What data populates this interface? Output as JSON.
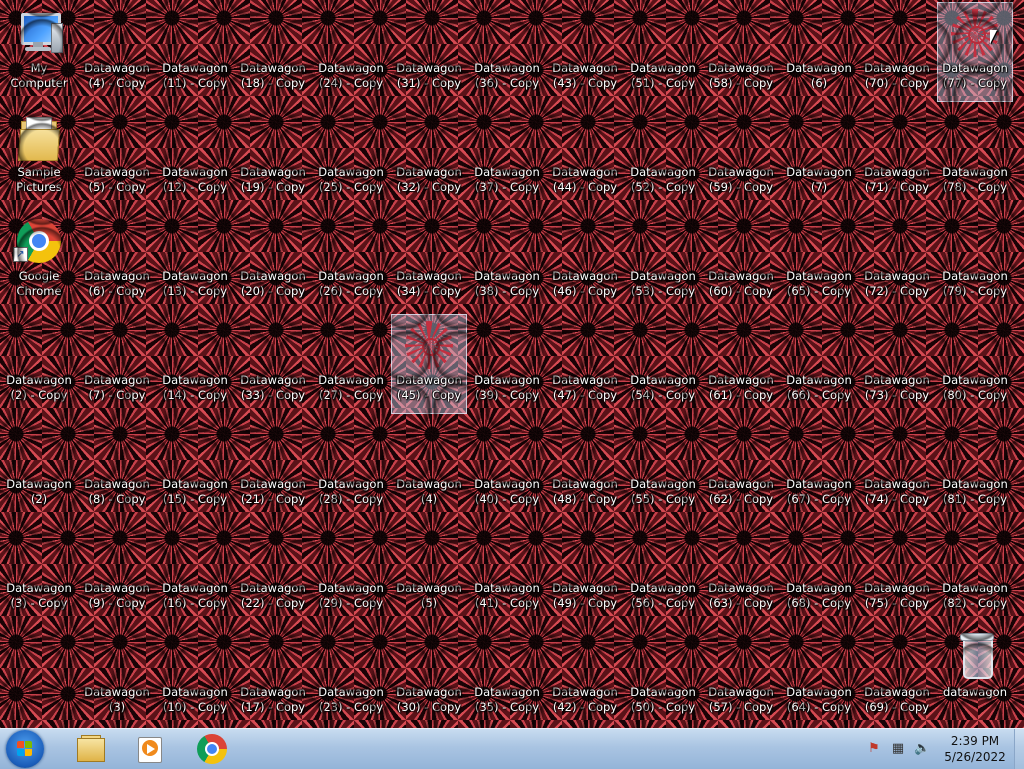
{
  "desktop": {
    "system_icons": [
      {
        "name": "my-computer-icon",
        "label": "My Computer",
        "kind": "computer",
        "col": 0,
        "row": 0
      },
      {
        "name": "sample-pictures-icon",
        "label": "Sample Pictures",
        "kind": "folder",
        "col": 0,
        "row": 1
      },
      {
        "name": "google-chrome-icon",
        "label": "Google Chrome",
        "kind": "chrome",
        "col": 0,
        "row": 2
      },
      {
        "name": "recycle-bin-icon",
        "label": "datawagon",
        "kind": "bin",
        "col": 12,
        "row": 6
      }
    ],
    "file_icons": [
      [
        "Datawagon (4) - Copy",
        "Datawagon (11) - Copy",
        "Datawagon (18) - Copy",
        "Datawagon (24) - Copy",
        "Datawagon (31) - Copy",
        "Datawagon (36) - Copy",
        "Datawagon (43) - Copy",
        "Datawagon (51) - Copy",
        "Datawagon (58) - Copy",
        "Datawagon (6)",
        "Datawagon (70) - Copy",
        "Datawagon (77) - Copy"
      ],
      [
        "Datawagon (5) - Copy",
        "Datawagon (12) - Copy",
        "Datawagon (19) - Copy",
        "Datawagon (25) - Copy",
        "Datawagon (32) - Copy",
        "Datawagon (37) - Copy",
        "Datawagon (44) - Copy",
        "Datawagon (52) - Copy",
        "Datawagon (59) - Copy",
        "Datawagon (7)",
        "Datawagon (71) - Copy",
        "Datawagon (78) - Copy"
      ],
      [
        "Datawagon (6) - Copy",
        "Datawagon (13) - Copy",
        "Datawagon (20) - Copy",
        "Datawagon (26) - Copy",
        "Datawagon (34) - Copy",
        "Datawagon (38) - Copy",
        "Datawagon (46) - Copy",
        "Datawagon (53) - Copy",
        "Datawagon (60) - Copy",
        "Datawagon (65) - Copy",
        "Datawagon (72) - Copy",
        "Datawagon (79) - Copy"
      ],
      [
        "Datawagon (2) - Copy",
        "Datawagon (7) - Copy",
        "Datawagon (14) - Copy",
        "Datawagon (33) - Copy",
        "Datawagon (27) - Copy",
        "Datawagon (45) - Copy",
        "Datawagon (39) - Copy",
        "Datawagon (47) - Copy",
        "Datawagon (54) - Copy",
        "Datawagon (61) - Copy",
        "Datawagon (66) - Copy",
        "Datawagon (73) - Copy",
        "Datawagon (80) - Copy"
      ],
      [
        "Datawagon (2)",
        "Datawagon (8) - Copy",
        "Datawagon (15) - Copy",
        "Datawagon (21) - Copy",
        "Datawagon (28) - Copy",
        "Datawagon (4)",
        "Datawagon (40) - Copy",
        "Datawagon (48) - Copy",
        "Datawagon (55) - Copy",
        "Datawagon (62) - Copy",
        "Datawagon (67) - Copy",
        "Datawagon (74) - Copy",
        "Datawagon (81) - Copy"
      ],
      [
        "Datawagon (3) - Copy",
        "Datawagon (9) - Copy",
        "Datawagon (16) - Copy",
        "Datawagon (22) - Copy",
        "Datawagon (29) - Copy",
        "Datawagon (5)",
        "Datawagon (41) - Copy",
        "Datawagon (49) - Copy",
        "Datawagon (56) - Copy",
        "Datawagon (63) - Copy",
        "Datawagon (68) - Copy",
        "Datawagon (75) - Copy",
        "Datawagon (82) - Copy"
      ],
      [
        "Datawagon (3)",
        "Datawagon (10) - Copy",
        "Datawagon (17) - Copy",
        "Datawagon (23) - Copy",
        "Datawagon (30) - Copy",
        "Datawagon (35) - Copy",
        "Datawagon (42) - Copy",
        "Datawagon (50) - Copy",
        "Datawagon (57) - Copy",
        "Datawagon (64) - Copy",
        "Datawagon (69) - Copy",
        "Datawagon (76) - Copy"
      ]
    ],
    "selected_labels": [
      "Datawagon (45) - Copy",
      "Datawagon (77) - Copy"
    ]
  },
  "taskbar": {
    "start_label": "Start",
    "pinned": [
      {
        "name": "explorer-taskbar-button",
        "icon": "folder-icon"
      },
      {
        "name": "media-player-taskbar-button",
        "icon": "media-player-icon"
      },
      {
        "name": "chrome-taskbar-button",
        "icon": "chrome-icon"
      }
    ],
    "tray": {
      "time": "2:39 PM",
      "date": "5/26/2022",
      "icons": [
        "action-center-flag-icon",
        "network-icon",
        "volume-icon"
      ]
    }
  },
  "colors": {
    "taskbar_top": "#c8dcf0",
    "taskbar_bottom": "#94b4d8",
    "wallpaper_red": "#c8404a",
    "selection": "#c8dcf5"
  }
}
